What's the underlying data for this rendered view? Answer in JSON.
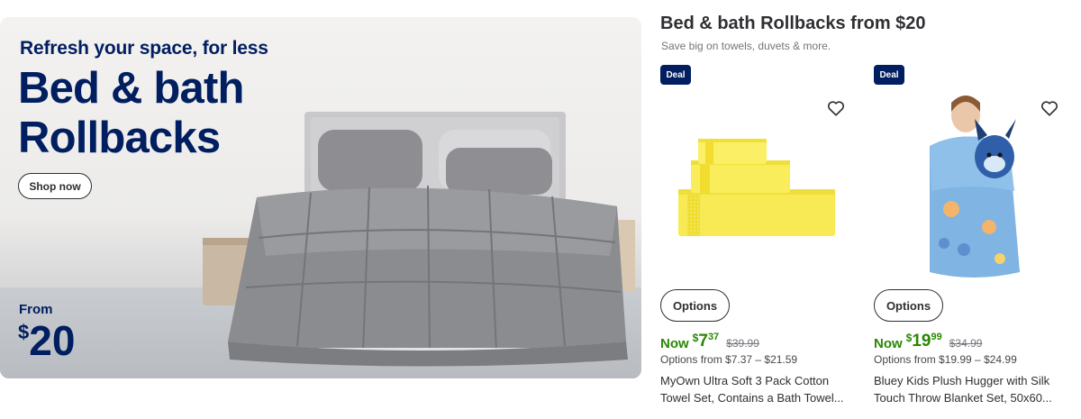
{
  "hero": {
    "eyebrow": "Refresh your space, for less",
    "title_line1": "Bed & bath",
    "title_line2": "Rollbacks",
    "cta_label": "Shop now",
    "from_label": "From",
    "price_currency": "$",
    "price_amount": "20"
  },
  "section": {
    "title": "Bed & bath Rollbacks from $20",
    "subtitle": "Save big on towels, duvets & more."
  },
  "products": [
    {
      "badge": "Deal",
      "favorite_icon": "heart-outline-icon",
      "image_icon": "yellow-towel-set",
      "options_label": "Options",
      "now_label": "Now",
      "price_currency": "$",
      "price_dollars": "7",
      "price_cents": "37",
      "was_price": "$39.99",
      "options_range": "Options from $7.37 – $21.59",
      "name_line1": "MyOwn Ultra Soft 3 Pack Cotton",
      "name_line2": "Towel Set, Contains a Bath Towel..."
    },
    {
      "badge": "Deal",
      "favorite_icon": "heart-outline-icon",
      "image_icon": "bluey-hugger-blanket",
      "options_label": "Options",
      "now_label": "Now",
      "price_currency": "$",
      "price_dollars": "19",
      "price_cents": "99",
      "was_price": "$34.99",
      "options_range": "Options from $19.99 – $24.99",
      "name_line1": "Bluey Kids Plush Hugger with Silk",
      "name_line2": "Touch Throw Blanket Set, 50x60..."
    }
  ],
  "colors": {
    "brand_navy": "#001e60",
    "rollback_green": "#2a8703",
    "text_dark": "#2e2f32",
    "text_muted": "#74767c"
  }
}
